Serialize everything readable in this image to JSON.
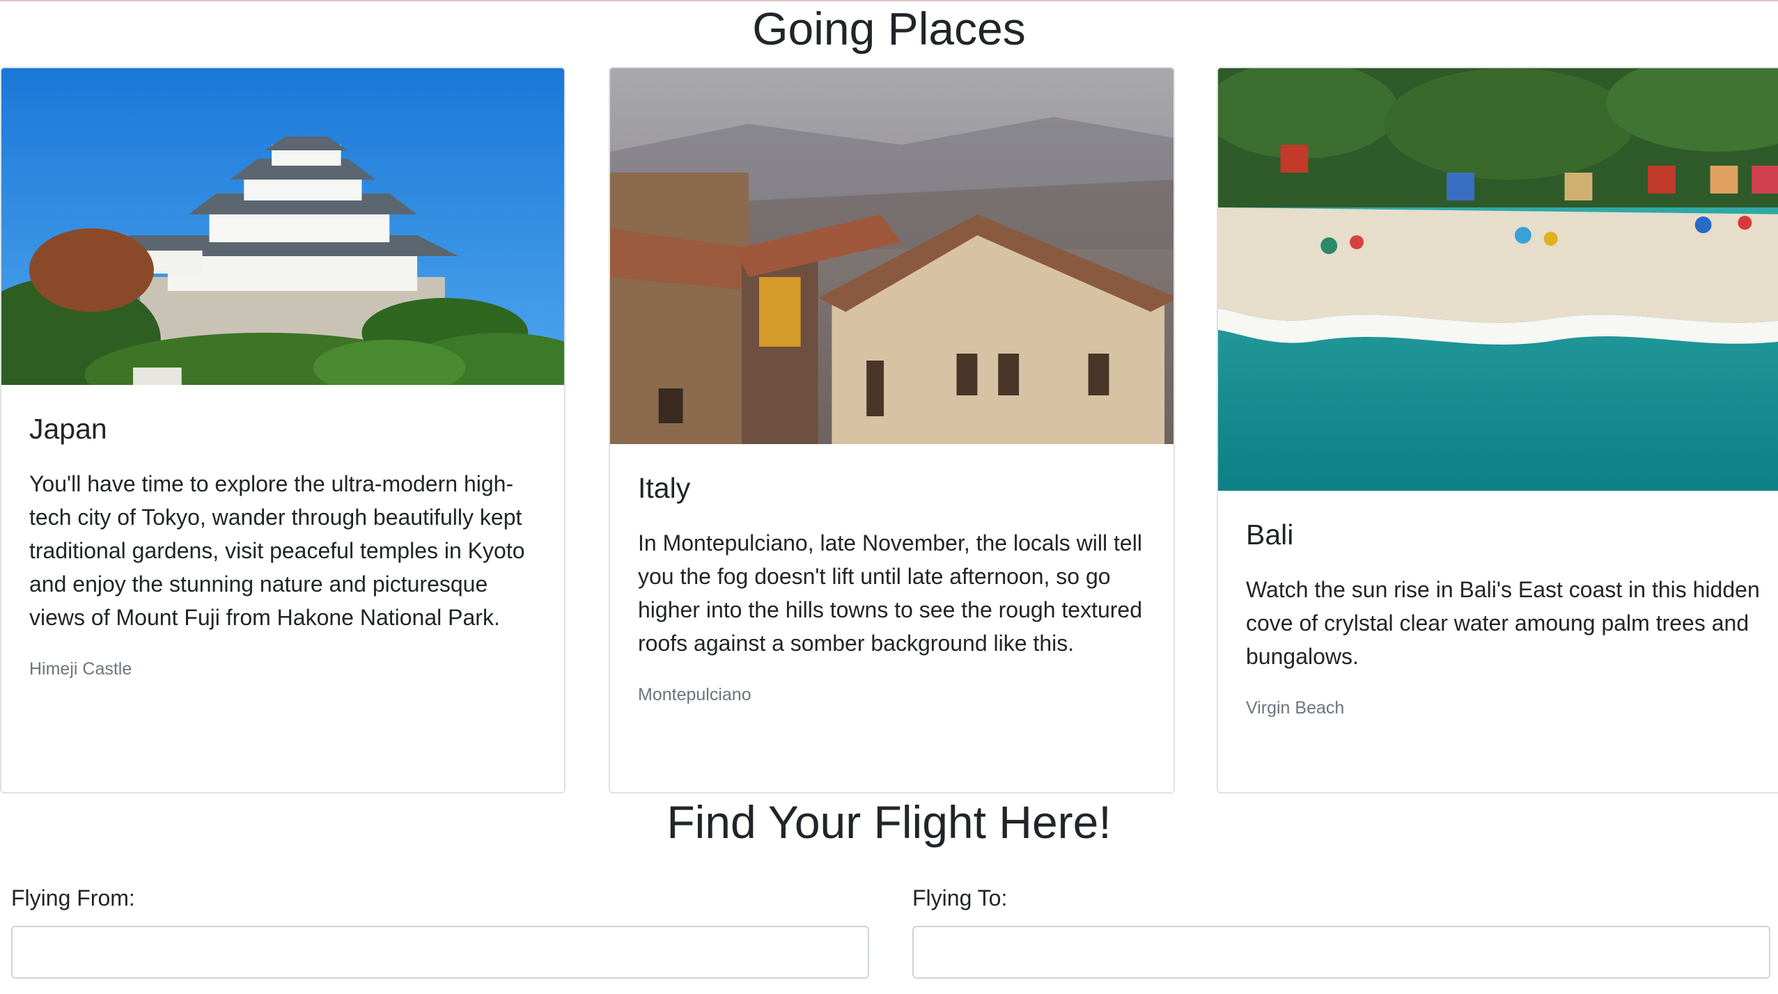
{
  "page": {
    "title": "Going Places",
    "flight_title": "Find Your Flight Here!"
  },
  "cards": [
    {
      "title": "Japan",
      "text": "You'll have time to explore the ultra-modern high-tech city of Tokyo, wander through beautifully kept traditional gardens, visit peaceful temples in Kyoto and enjoy the stunning nature and picturesque views of Mount Fuji from Hakone National Park.",
      "subtitle": "Himeji Castle"
    },
    {
      "title": "Italy",
      "text": "In Montepulciano, late November, the locals will tell you the fog doesn't lift until late afternoon, so go higher into the hills towns to see the rough textured roofs against a somber background like this.",
      "subtitle": "Montepulciano"
    },
    {
      "title": "Bali",
      "text": "Watch the sun rise in Bali's East coast in this hidden cove of crylstal clear water amoung palm trees and bungalows.",
      "subtitle": "Virgin Beach"
    }
  ],
  "form": {
    "from_label": "Flying From:",
    "from_value": "",
    "to_label": "Flying To:",
    "to_value": ""
  },
  "colors": {
    "text": "#212529",
    "muted": "#6c757d",
    "border": "#dfe2e5"
  }
}
